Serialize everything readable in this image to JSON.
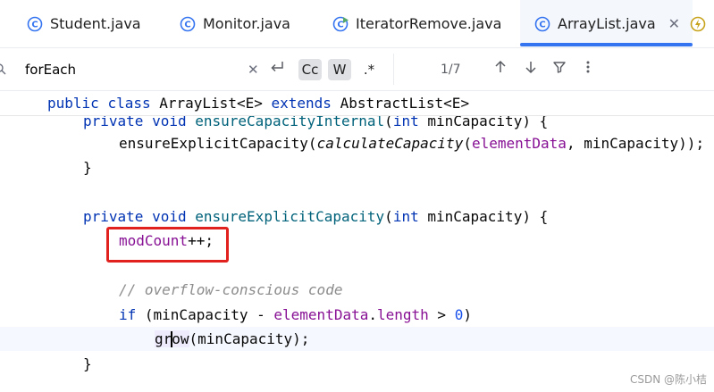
{
  "tabs": [
    {
      "label": "Student.java",
      "icon": "class-icon"
    },
    {
      "label": "Monitor.java",
      "icon": "class-icon"
    },
    {
      "label": "IteratorRemove.java",
      "icon": "runnable-class-icon"
    },
    {
      "label": "ArrayList.java",
      "icon": "class-icon",
      "active": true
    },
    {
      "label": "",
      "icon": "lightning-icon"
    }
  ],
  "search": {
    "query": "forEach",
    "match_case_label": "Cc",
    "words_label": "W",
    "regex_label": ".*",
    "counter": "1/7"
  },
  "sticky_header": {
    "public": "public",
    "class": "class",
    "name": "ArrayList",
    "type_param": "<E>",
    "extends": "extends",
    "super": "AbstractList<E>"
  },
  "code": {
    "l1": {
      "mod": "private",
      "type": "void",
      "name": "ensureCapacityInternal",
      "open": "(",
      "ptype": "int",
      "param": "minCapacity",
      "close": ") {"
    },
    "l2": {
      "call": "ensureExplicitCapacity",
      "open": "(",
      "inner": "calculateCapacity",
      "open2": "(",
      "arg1": "elementData",
      "sep": ", ",
      "arg2": "minCapacity",
      "close": "));"
    },
    "l3": "}",
    "l5": {
      "mod": "private",
      "type": "void",
      "name": "ensureExplicitCapacity",
      "open": "(",
      "ptype": "int",
      "param": "minCapacity",
      "close": ") {"
    },
    "l6": {
      "field": "modCount",
      "rest": "++;"
    },
    "l8": "// overflow-conscious code",
    "l9": {
      "if": "if",
      "open": " (minCapacity - ",
      "field": "elementData",
      "dot": ".",
      "member": "length",
      "gt": " > ",
      "zero": "0",
      "close": ")"
    },
    "l10": {
      "pre": "gr",
      "post": "ow",
      "rest": "(minCapacity);"
    },
    "l11": "}"
  },
  "watermark": "CSDN @陈小桔",
  "colors": {
    "keyword": "#0033b3",
    "method": "#00627a",
    "field": "#871094",
    "comment": "#8c8c8c",
    "number": "#1750eb",
    "accent": "#3574f0",
    "annotation_box": "#e0211d"
  }
}
